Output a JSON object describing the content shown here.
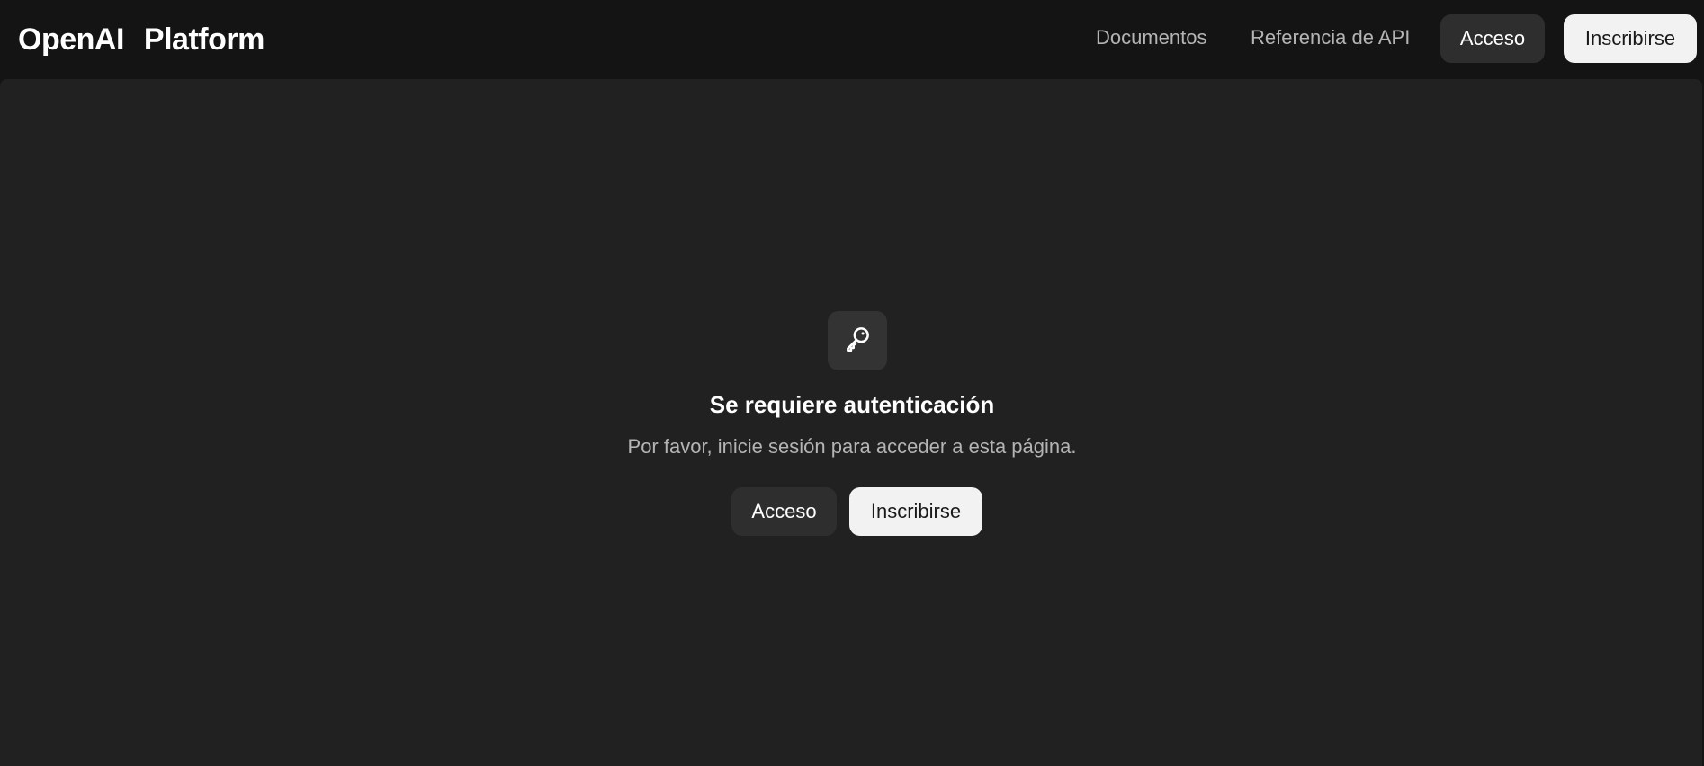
{
  "header": {
    "brand": "OpenAI",
    "brand_product": "Platform",
    "nav": {
      "docs": "Documentos",
      "api_reference": "Referencia de API"
    },
    "login_label": "Acceso",
    "signup_label": "Inscribirse"
  },
  "auth_prompt": {
    "icon": "key-icon",
    "title": "Se requiere autenticación",
    "message": "Por favor, inicie sesión para acceder a esta página.",
    "login_label": "Acceso",
    "signup_label": "Inscribirse"
  },
  "colors": {
    "page_bg": "#141414",
    "panel_bg": "#212121",
    "icon_tile": "#333333",
    "dark_button": "#2e2e2e",
    "light_button": "#f2f2f2"
  }
}
